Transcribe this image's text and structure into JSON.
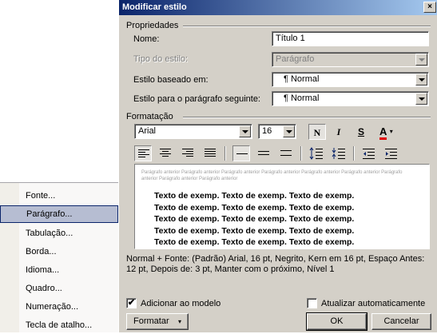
{
  "menu": {
    "items": [
      {
        "label": "Fonte..."
      },
      {
        "label": "Parágrafo..."
      },
      {
        "label": "Tabulação..."
      },
      {
        "label": "Borda..."
      },
      {
        "label": "Idioma..."
      },
      {
        "label": "Quadro..."
      },
      {
        "label": "Numeração..."
      },
      {
        "label": "Tecla de atalho..."
      }
    ],
    "selected_label": "Parágrafo..."
  },
  "dialog": {
    "title": "Modificar estilo",
    "close_glyph": "×",
    "properties_label": "Propriedades",
    "name_label": "Nome:",
    "name_value": "Título 1",
    "style_type_label": "Tipo do estilo:",
    "style_type_value": "Parágrafo",
    "based_on_label": "Estilo baseado em:",
    "based_on_value": "¶ Normal",
    "next_style_label": "Estilo para o parágrafo seguinte:",
    "next_style_value": "¶ Normal",
    "formatting_label": "Formatação",
    "font_value": "Arial",
    "size_value": "16",
    "bold_label": "N",
    "italic_label": "I",
    "underline_label": "S",
    "font_color_label": "A",
    "font_color": "#e00000",
    "preview_small": "Parágrafo anterior Parágrafo anterior Parágrafo anterior Parágrafo anterior Parágrafo anterior Parágrafo anterior Parágrafo anterior Parágrafo anterior Parágrafo anterior",
    "preview_lines": [
      "Texto de exemp. Texto de exemp. Texto de exemp.",
      "Texto de exemp. Texto de exemp. Texto de exemp.",
      "Texto de exemp. Texto de exemp. Texto de exemp.",
      "Texto de exemp. Texto de exemp. Texto de exemp.",
      "Texto de exemp. Texto de exemp. Texto de exemp."
    ],
    "description": "Normal + Fonte: (Padrão) Arial, 16 pt, Negrito, Kern em 16 pt, Espaço Antes: 12 pt, Depois de: 3 pt, Manter com o próximo, Nível 1",
    "add_to_template_label": "Adicionar ao modelo",
    "add_to_template_checked": true,
    "auto_update_label": "Atualizar automaticamente",
    "auto_update_checked": false,
    "format_button_label": "Formatar",
    "ok_label": "OK",
    "cancel_label": "Cancelar"
  }
}
